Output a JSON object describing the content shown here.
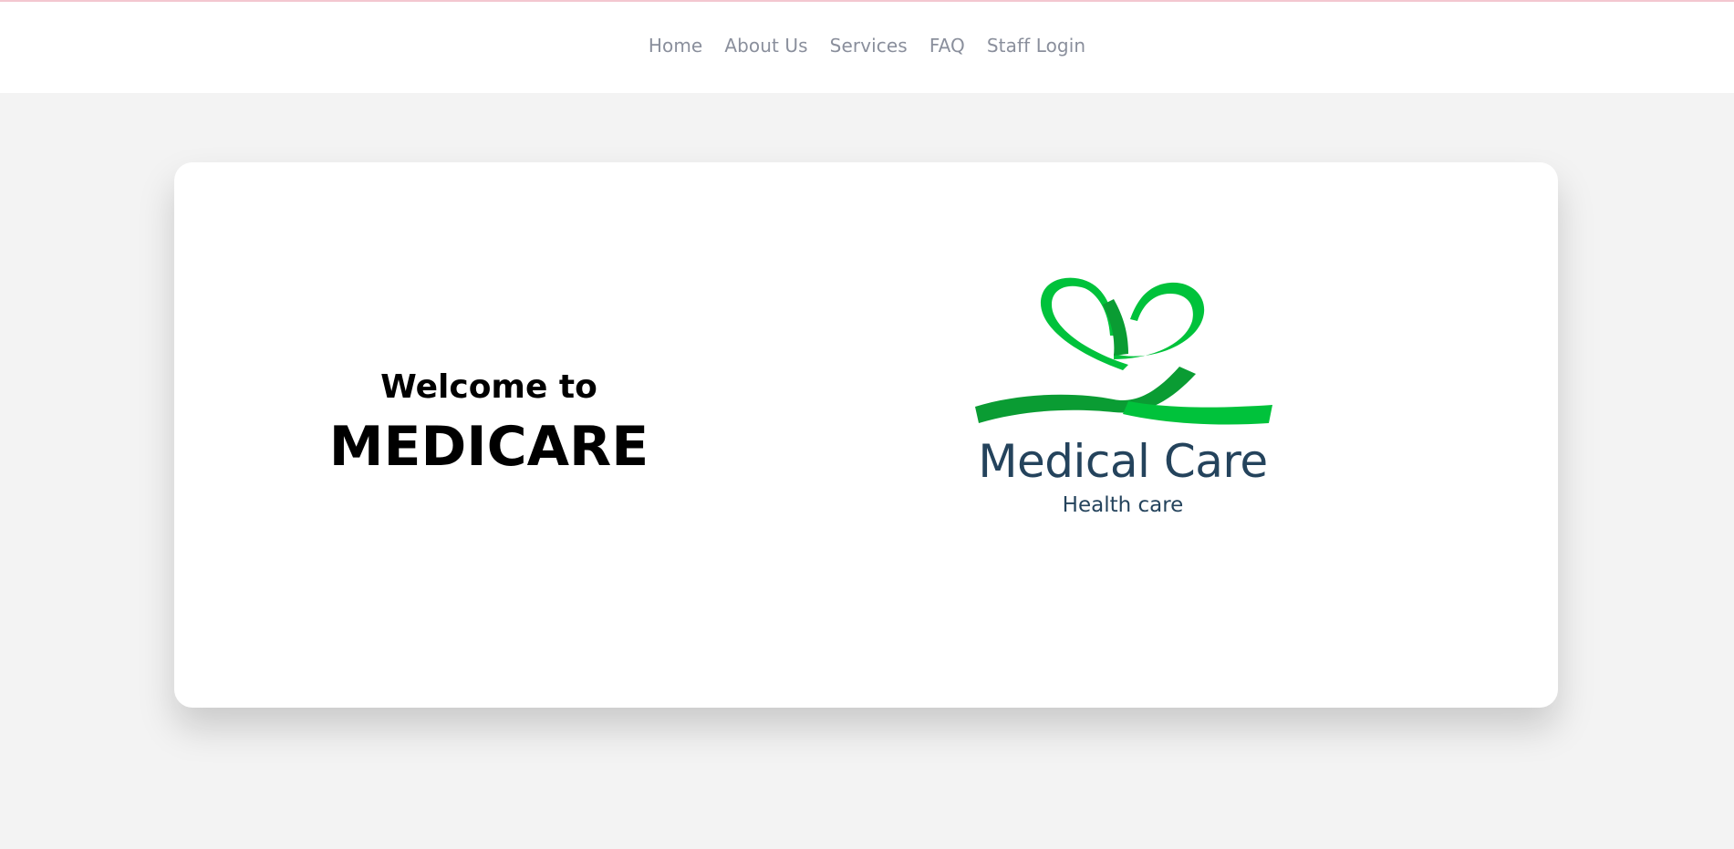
{
  "nav": {
    "items": [
      {
        "label": "Home"
      },
      {
        "label": "About Us"
      },
      {
        "label": "Services"
      },
      {
        "label": "FAQ"
      },
      {
        "label": "Staff Login"
      }
    ]
  },
  "hero": {
    "welcome": "Welcome to",
    "brand": "MEDICARE"
  },
  "logo": {
    "title": "Medical Care",
    "subtitle": "Health care",
    "icon": "heart-ribbon-icon"
  },
  "colors": {
    "page_background": "#f3f3f3",
    "nav_text": "#8a8f9c",
    "ribbon_green": "#00c23b",
    "ribbon_dark_green": "#0a9c33",
    "logo_text": "#24435c"
  }
}
